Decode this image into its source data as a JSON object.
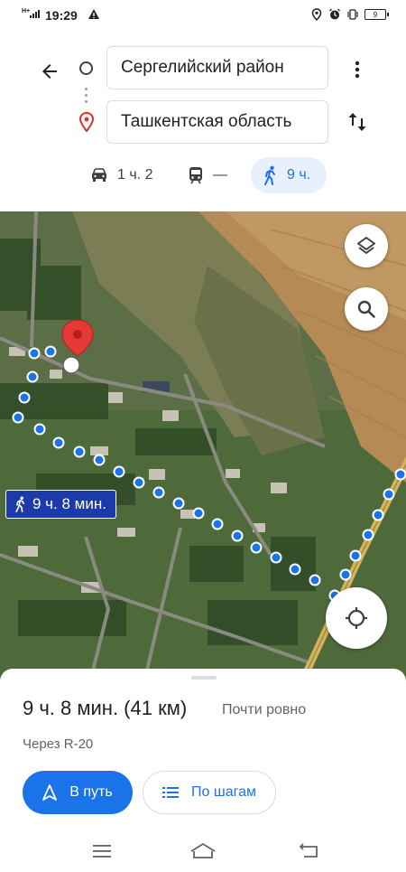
{
  "status_bar": {
    "network": "H+",
    "time": "19:29",
    "battery": "9"
  },
  "directions": {
    "origin": "Сергелийский район",
    "destination": "Ташкентская область"
  },
  "modes": [
    {
      "name": "car",
      "value": "1 ч. 2"
    },
    {
      "name": "transit",
      "value": "—"
    },
    {
      "name": "walk",
      "value": "9 ч."
    }
  ],
  "map": {
    "duration_label": "9 ч. 8 мин."
  },
  "summary": {
    "title": "9 ч. 8 мин. (41 км)",
    "traffic": "Почти ровно",
    "via": "Через R-20",
    "start_label": "В путь",
    "steps_label": "По шагам"
  },
  "colors": {
    "accent": "#1a73e8",
    "route": "#1a73e8",
    "pin": "#e53935"
  }
}
